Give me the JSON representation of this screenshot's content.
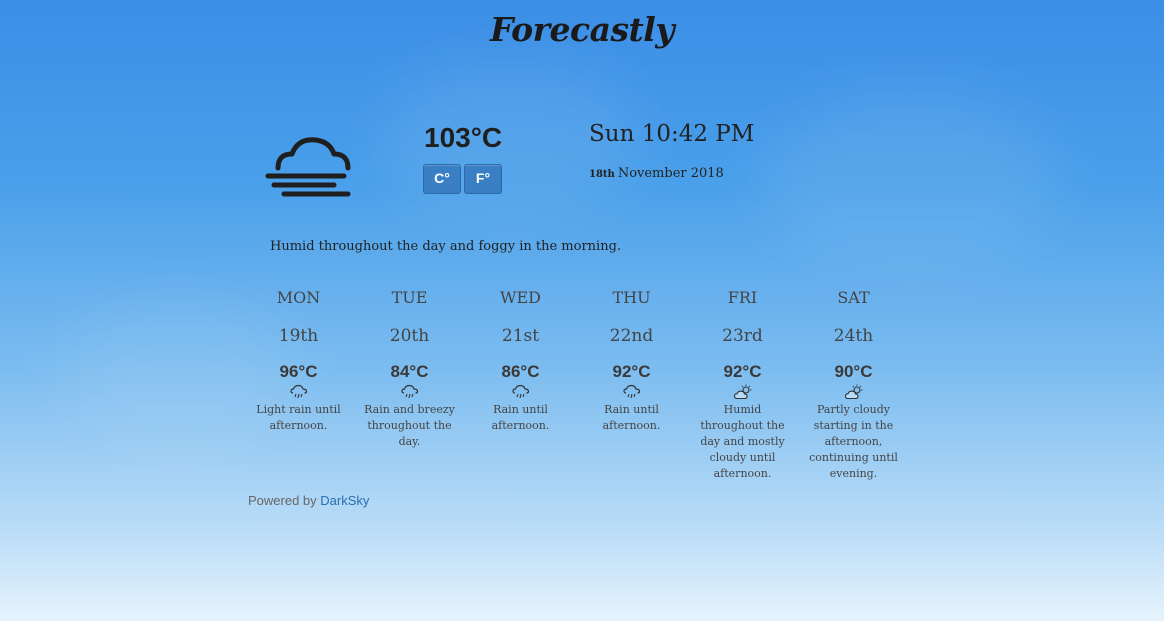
{
  "app": {
    "brand": "Forecastly"
  },
  "current": {
    "icon": "fog-icon",
    "temperature": "103°C",
    "unit_celsius_label": "C°",
    "unit_fahrenheit_label": "F°",
    "day_time": "Sun 10:42 PM",
    "day_number": "18th",
    "month_year": "November 2018",
    "summary": "Humid throughout the day and foggy in the morning."
  },
  "forecast": [
    {
      "day": "MON",
      "date": "19th",
      "temp": "96°C",
      "icon": "rain-icon",
      "summary": "Light rain until afternoon."
    },
    {
      "day": "TUE",
      "date": "20th",
      "temp": "84°C",
      "icon": "rain-icon",
      "summary": "Rain and breezy throughout the day."
    },
    {
      "day": "WED",
      "date": "21st",
      "temp": "86°C",
      "icon": "rain-icon",
      "summary": "Rain until afternoon."
    },
    {
      "day": "THU",
      "date": "22nd",
      "temp": "92°C",
      "icon": "rain-icon",
      "summary": "Rain until afternoon."
    },
    {
      "day": "FRI",
      "date": "23rd",
      "temp": "92°C",
      "icon": "partly-cloudy-day-icon",
      "summary": "Humid throughout the day and mostly cloudy until afternoon."
    },
    {
      "day": "SAT",
      "date": "24th",
      "temp": "90°C",
      "icon": "partly-cloudy-day-icon",
      "summary": "Partly cloudy starting in the afternoon, continuing until evening."
    }
  ],
  "footer": {
    "powered_by": "Powered by",
    "provider": "DarkSky"
  },
  "colors": {
    "accent_button": "#3a7fc4",
    "link": "#2a6fb0",
    "sky_top": "#3b8ee6",
    "sky_bottom": "#e6f3fc"
  }
}
